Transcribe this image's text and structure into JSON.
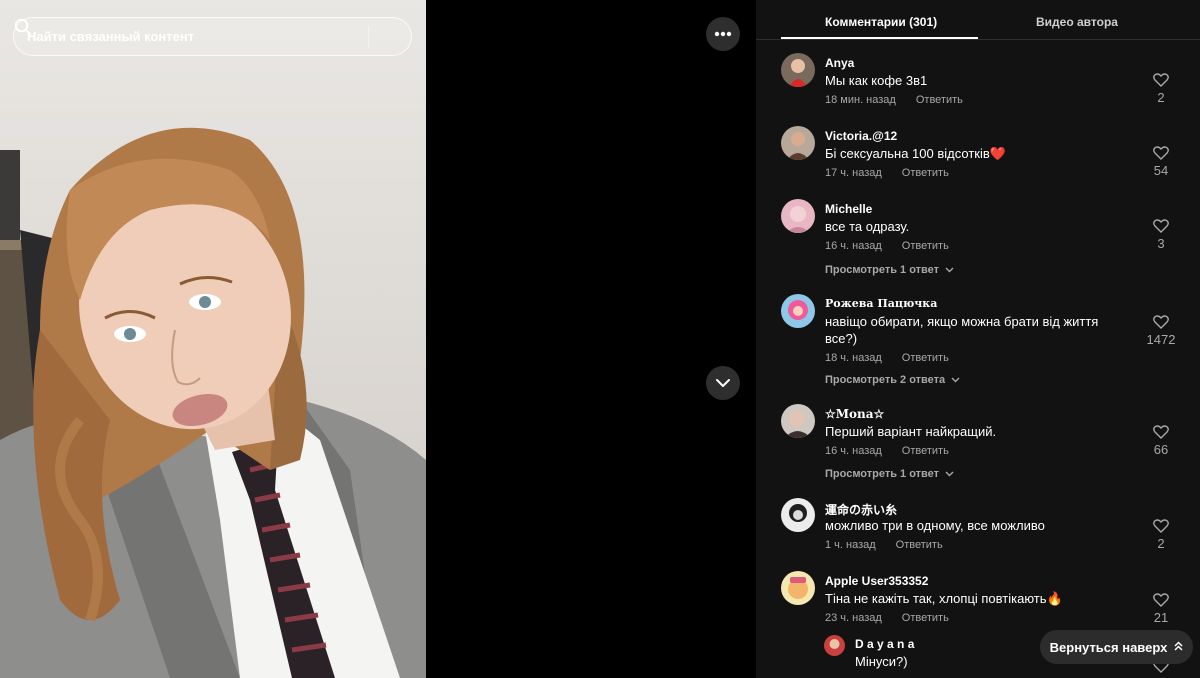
{
  "search": {
    "placeholder": "Найти связанный контент"
  },
  "tabs": {
    "comments": "Комментарии (301)",
    "videos": "Видео автора"
  },
  "reply_label": "Ответить",
  "comments": [
    {
      "user": "Anya",
      "text": "Мы как кофе 3в1",
      "time": "18 мин. назад",
      "likes": "2"
    },
    {
      "user": "Victoria.@12",
      "text": "Бі сексуальна 100 відсотків❤️",
      "time": "17 ч. назад",
      "likes": "54"
    },
    {
      "user": "Michelle",
      "text": "все та одразу.",
      "time": "16 ч. назад",
      "likes": "3",
      "more": "Просмотреть 1 ответ"
    },
    {
      "user": "Рожева Пацючка",
      "text": "навіщо обирати, якщо можна брати від життя все?)",
      "time": "18 ч. назад",
      "likes": "1472",
      "more": "Просмотреть 2 ответа"
    },
    {
      "user": "☆Mona☆",
      "text": "Перший варіант найкращий.",
      "time": "16 ч. назад",
      "likes": "66",
      "more": "Просмотреть 1 ответ"
    },
    {
      "user": "運命の赤い糸",
      "text": "можливо три в одному, все можливо",
      "time": "1 ч. назад",
      "likes": "2"
    },
    {
      "user": "Apple User353352",
      "text": "Тіна не кажіть так, хлопці повтікають🔥",
      "time": "23 ч. назад",
      "likes": "21"
    }
  ],
  "reply_preview": {
    "user": "D a y a n a",
    "text": "Мінуси?)"
  },
  "back_to_top": "Вернуться наверх",
  "colors": {
    "background": "#121212",
    "muted": "#a8a8a8",
    "divider": "#2d2d2d"
  }
}
